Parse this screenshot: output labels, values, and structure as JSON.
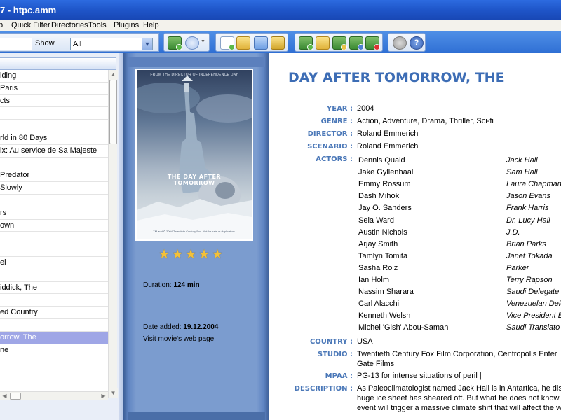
{
  "window": {
    "title": "7 - htpc.amm"
  },
  "menu": {
    "items": [
      {
        "label": "p"
      },
      {
        "label": "Quick Filter"
      },
      {
        "label": "Directories"
      },
      {
        "label": "Tools"
      },
      {
        "label": "Plugins"
      },
      {
        "label": "Help"
      }
    ]
  },
  "toolbar": {
    "show_label": "Show",
    "search_value": "",
    "filter_value": "All",
    "icons": [
      "film-add-icon",
      "play-icon",
      "page-add-icon",
      "folder-open-icon",
      "scan-icon",
      "key-icon",
      "film-new-icon",
      "folder-icon",
      "film-edit-icon",
      "film-refresh-icon",
      "film-delete-icon",
      "settings-icon",
      "help-icon"
    ]
  },
  "list": {
    "items": [
      "lding",
      "Paris",
      "cts",
      "",
      "",
      "rld in 80 Days",
      "ix: Au service de Sa Majeste",
      "",
      "Predator",
      "Slowly",
      "",
      "rs",
      "own",
      "",
      "",
      "el",
      "",
      "iddick, The",
      "",
      "ed Country",
      "",
      "orrow, The",
      "ne"
    ],
    "selected_index": 21
  },
  "details": {
    "title": "DAY AFTER TOMORROW, THE",
    "poster": {
      "tagline": "FROM THE DIRECTOR OF INDEPENDENCE DAY",
      "title_line1": "THE DAY AFTER",
      "title_line2": "TOMORROW",
      "credits": "TM and © 2004 Twentieth Century Fox. Not for sale or duplication."
    },
    "rating_stars": 5,
    "duration_label": "Duration:",
    "duration_value": "124 min",
    "date_added_label": "Date added:",
    "date_added_value": "19.12.2004",
    "web_link": "Visit movie's web page",
    "labels": {
      "year": "YEAR :",
      "genre": "GENRE :",
      "director": "DIRECTOR :",
      "scenario": "SCENARIO :",
      "actors": "ACTORS :",
      "country": "COUNTRY :",
      "studio": "STUDIO :",
      "mpaa": "MPAA :",
      "description": "DESCRIPTION :"
    },
    "year": "2004",
    "genre": "Action, Adventure, Drama, Thriller, Sci-fi",
    "director": "Roland Emmerich",
    "scenario": "Roland Emmerich",
    "actors": [
      {
        "name": "Dennis Quaid",
        "role": "Jack Hall"
      },
      {
        "name": "Jake Gyllenhaal",
        "role": "Sam Hall"
      },
      {
        "name": "Emmy Rossum",
        "role": "Laura Chapman"
      },
      {
        "name": "Dash Mihok",
        "role": "Jason Evans"
      },
      {
        "name": "Jay O. Sanders",
        "role": "Frank Harris"
      },
      {
        "name": "Sela Ward",
        "role": "Dr. Lucy Hall"
      },
      {
        "name": "Austin Nichols",
        "role": "J.D."
      },
      {
        "name": "Arjay Smith",
        "role": "Brian Parks"
      },
      {
        "name": "Tamlyn Tomita",
        "role": "Janet Tokada"
      },
      {
        "name": "Sasha Roiz",
        "role": "Parker"
      },
      {
        "name": "Ian Holm",
        "role": "Terry Rapson"
      },
      {
        "name": "Nassim Sharara",
        "role": "Saudi Delegate"
      },
      {
        "name": "Carl Alacchi",
        "role": "Venezuelan Dele"
      },
      {
        "name": "Kenneth Welsh",
        "role": "Vice President B"
      },
      {
        "name": "Michel 'Gish' Abou-Samah",
        "role": "Saudi Translato"
      }
    ],
    "country": "USA",
    "studio_line1": "Twentieth Century Fox Film Corporation, Centropolis Enter",
    "studio_line2": "Gate Films",
    "mpaa": "PG-13 for intense situations of peril |",
    "description_line1": "As Paleoclimatologist named Jack Hall is in Antartica, he disc",
    "description_line2": "huge ice sheet has sheared off. But what he does not know",
    "description_line3": "event will trigger a massive climate shift that will affect the w"
  }
}
